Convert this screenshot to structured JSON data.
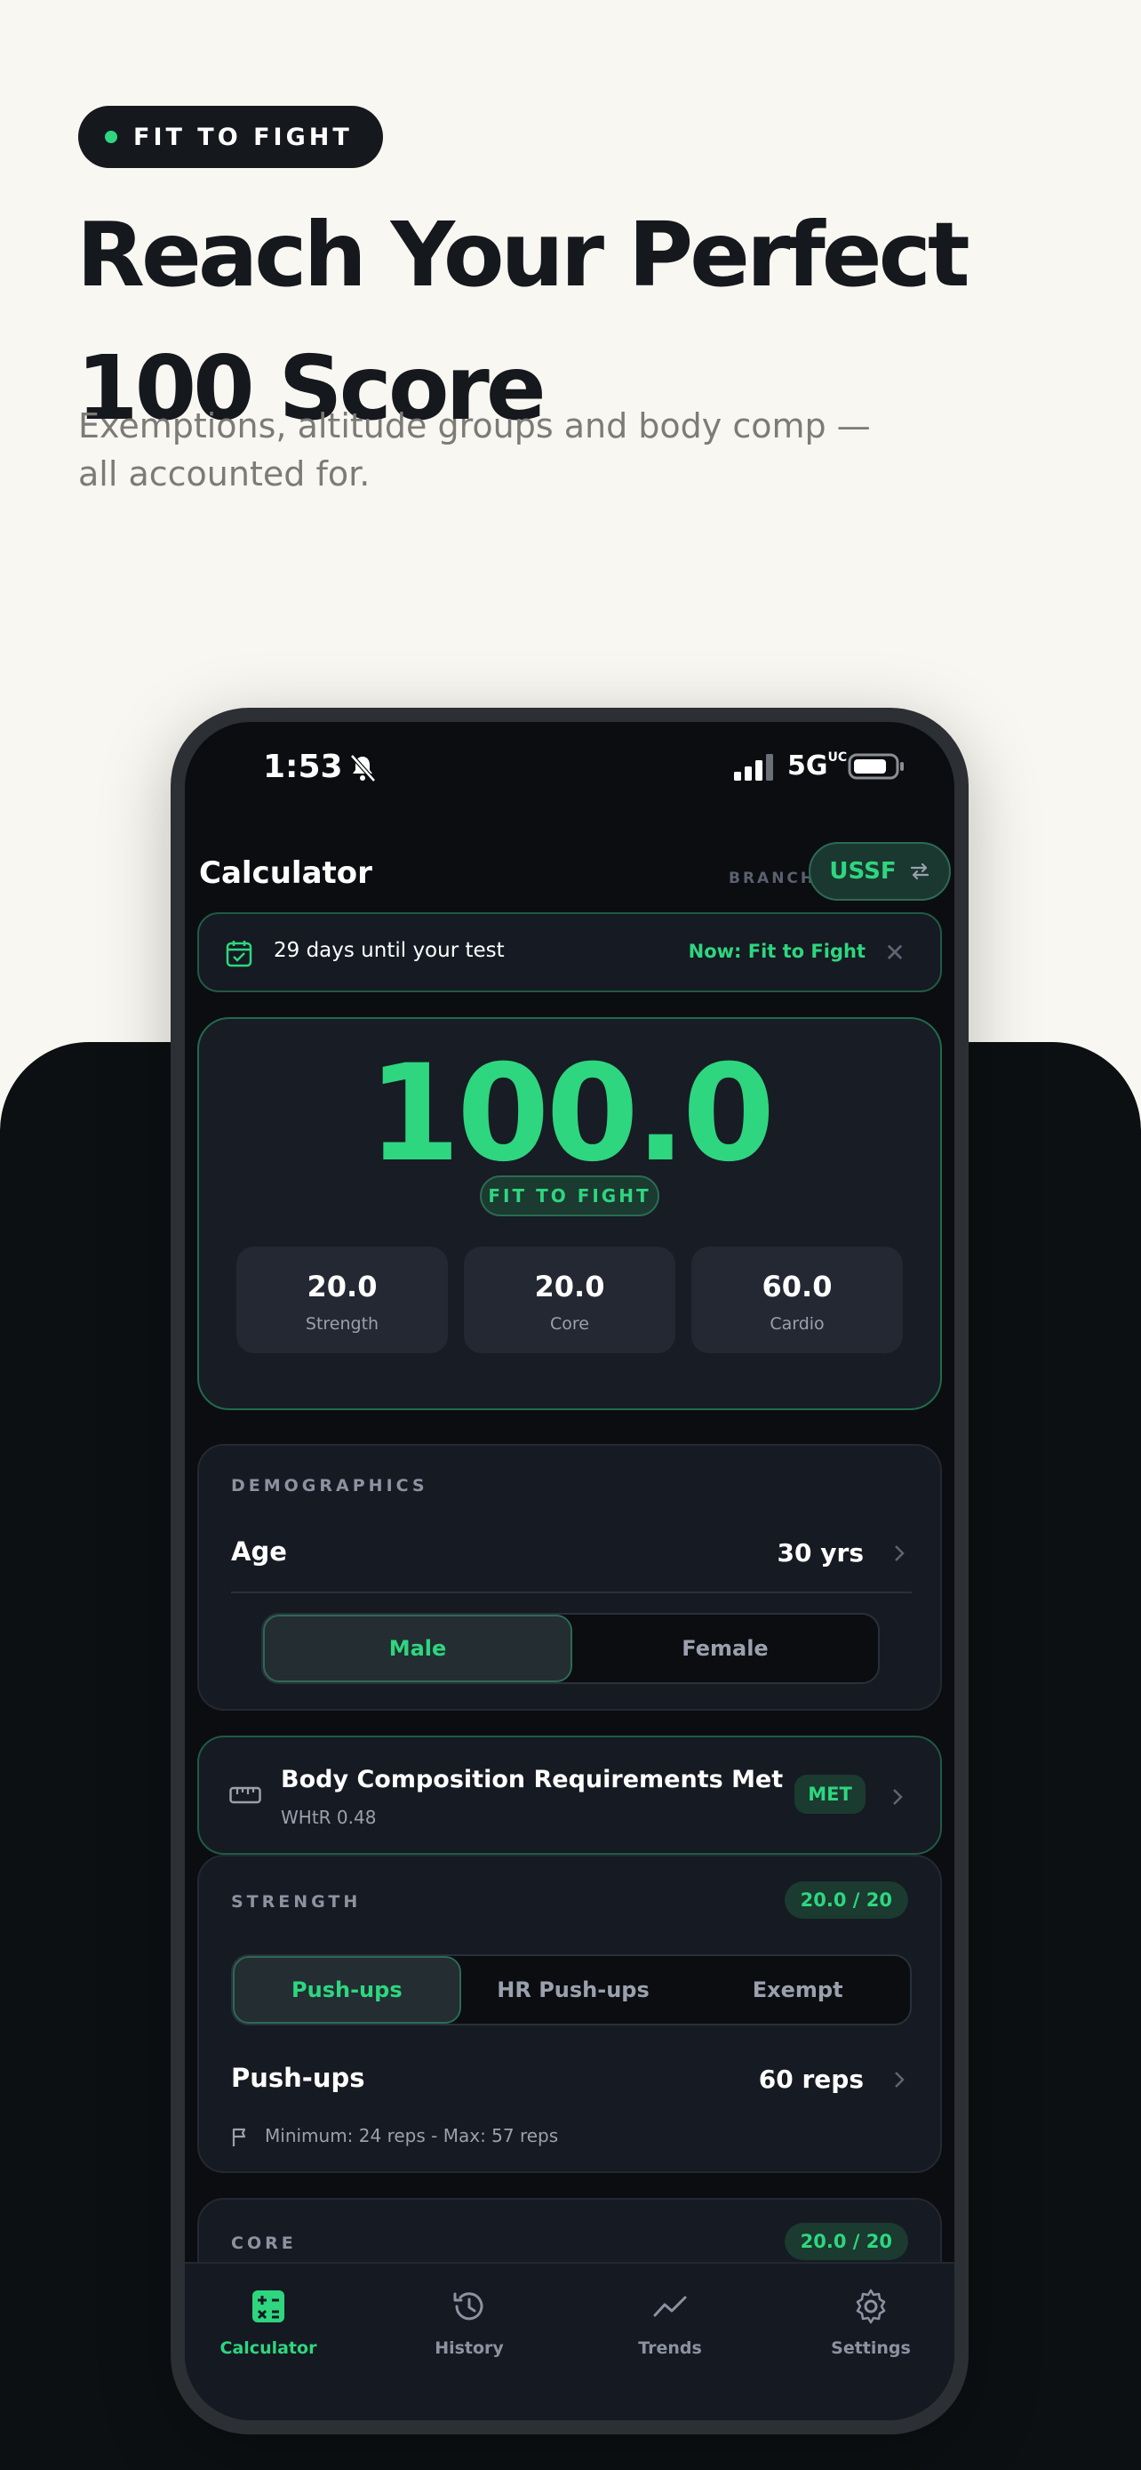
{
  "promo": {
    "tag": "FIT TO FIGHT",
    "headline_line1": "Reach Your Perfect",
    "headline_line2": "100 Score",
    "subtitle": "Exemptions, altitude groups and body comp — all accounted for."
  },
  "status_bar": {
    "time": "1:53",
    "network": "5G",
    "network_sup": "UC"
  },
  "header": {
    "title": "Calculator",
    "branch_label": "BRANCH",
    "branch_value": "USSF"
  },
  "countdown": {
    "message": "29 days until your test",
    "now_label": "Now: Fit to Fight",
    "close": "✕"
  },
  "score": {
    "total": "100.0",
    "badge": "FIT TO FIGHT",
    "components": [
      {
        "value": "20.0",
        "label": "Strength"
      },
      {
        "value": "20.0",
        "label": "Core"
      },
      {
        "value": "60.0",
        "label": "Cardio"
      }
    ]
  },
  "demographics": {
    "section": "DEMOGRAPHICS",
    "age_label": "Age",
    "age_value": "30 yrs",
    "sex_options": [
      "Male",
      "Female"
    ],
    "sex_selected": "Male"
  },
  "body_comp": {
    "title": "Body Composition Requirements Met",
    "detail": "WHtR 0.48",
    "badge": "MET"
  },
  "strength": {
    "section": "STRENGTH",
    "points": "20.0 / 20",
    "options": [
      "Push-ups",
      "HR Push-ups",
      "Exempt"
    ],
    "selected": "Push-ups",
    "exercise_label": "Push-ups",
    "exercise_value": "60 reps",
    "minmax": "Minimum: 24 reps  -  Max: 57 reps"
  },
  "core": {
    "section": "CORE",
    "points": "20.0 / 20"
  },
  "tabs": [
    {
      "label": "Calculator",
      "icon": "calculator-icon",
      "active": true
    },
    {
      "label": "History",
      "icon": "history-icon",
      "active": false
    },
    {
      "label": "Trends",
      "icon": "trends-icon",
      "active": false
    },
    {
      "label": "Settings",
      "icon": "gear-icon",
      "active": false
    }
  ],
  "colors": {
    "accent": "#2ed67f",
    "background": "#0b0d10",
    "card": "#161a22",
    "promo_bg": "#f9f7f1"
  }
}
